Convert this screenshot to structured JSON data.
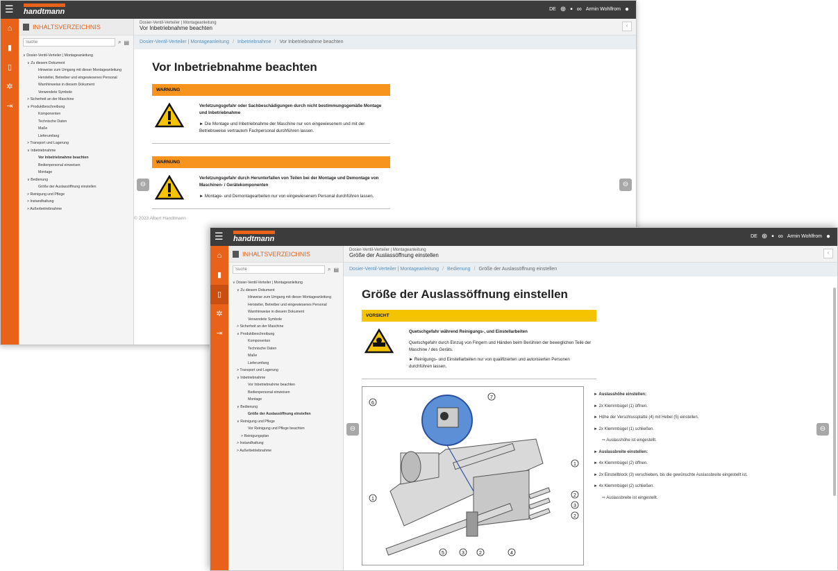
{
  "app": {
    "logo": "handtmann",
    "lang": "DE",
    "user": "Armin Wohlfrom",
    "toc_title": "INHALTSVERZEICHNIS",
    "search_placeholder": "Suche",
    "doc_title": "Dosier-Ventil-Verteiler | Montageanleitung"
  },
  "toc": [
    {
      "label": "Dosier-Ventil-Verteiler | Montageanleitung",
      "lvl": 1,
      "arrow": "∨"
    },
    {
      "label": "Zu diesem Dokument",
      "lvl": 2,
      "arrow": "∨"
    },
    {
      "label": "Hinweise zum Umgang mit dieser Montageanleitung",
      "lvl": 4
    },
    {
      "label": "Hersteller, Betreiber und eingewiesenes Personal",
      "lvl": 4
    },
    {
      "label": "Warnhinweise in diesem Dokument",
      "lvl": 4
    },
    {
      "label": "Verwendete Symbole",
      "lvl": 4
    },
    {
      "label": "Sicherheit an der Maschine",
      "lvl": 2,
      "arrow": ">"
    },
    {
      "label": "Produktbeschreibung",
      "lvl": 2,
      "arrow": "∨"
    },
    {
      "label": "Komponenten",
      "lvl": 4
    },
    {
      "label": "Technische Daten",
      "lvl": 4
    },
    {
      "label": "Maße",
      "lvl": 4
    },
    {
      "label": "Lieferumfang",
      "lvl": 4
    },
    {
      "label": "Transport und Lagerung",
      "lvl": 2,
      "arrow": ">"
    },
    {
      "label": "Inbetriebnahme",
      "lvl": 2,
      "arrow": "∨"
    },
    {
      "label": "Vor Inbetriebnahme beachten",
      "lvl": 4,
      "key": "vib"
    },
    {
      "label": "Bedienpersonal einweisen",
      "lvl": 4
    },
    {
      "label": "Montage",
      "lvl": 4
    },
    {
      "label": "Bedienung",
      "lvl": 2,
      "arrow": "∨"
    },
    {
      "label": "Größe der Auslassöffnung einstellen",
      "lvl": 4,
      "key": "gae"
    },
    {
      "label": "Reinigung und Pflege",
      "lvl": 2,
      "arrow": ">"
    },
    {
      "label": "Instandhaltung",
      "lvl": 2,
      "arrow": ">"
    },
    {
      "label": "Außerbetriebnahme",
      "lvl": 2,
      "arrow": ">"
    }
  ],
  "toc2_extra": {
    "reinigung": "Reinigung und Pflege",
    "vor_reinigung": "Vor Reinigung und Pflege beachten",
    "plan": "Reinigungsplan"
  },
  "page1": {
    "header_sub": "Dosier-Ventil-Verteiler | Montageanleitung",
    "header_title": "Vor Inbetriebnahme beachten",
    "crumbs": [
      "Dosier-Ventil-Verteiler | Montageanleitung",
      "Inbetriebnahme",
      "Vor Inbetriebnahme beachten"
    ],
    "title": "Vor Inbetriebnahme beachten",
    "w1_label": "WARNUNG",
    "w1_bold": "Verletzungsgefahr oder Sachbeschädigungen durch nicht bestimmungsgemäße Montage und Inbetriebnahme",
    "w1_step": "Die Montage und Inbetriebnahme der Maschine nur von eingewiesenem und mit der Betriebsweise vertrautem Fachpersonal durchführen lassen.",
    "w2_label": "WARNUNG",
    "w2_bold": "Verletzungsgefahr durch Herunterfallen von Teilen bei der Montage und Demontage von Maschinen- / Gerätekomponenten",
    "w2_step": "Montage- und Demontagearbeiten nur von eingewiesenem Personal durchführen lassen.",
    "footer": "© 2023 Albert Handtmann"
  },
  "page2": {
    "header_sub": "Dosier-Ventil-Verteiler | Montageanleitung",
    "header_title": "Größe der Auslassöffnung einstellen",
    "crumbs": [
      "Dosier-Ventil-Verteiler | Montageanleitung",
      "Bedienung",
      "Größe der Auslassöffnung einstellen"
    ],
    "title": "Größe der Auslassöffnung einstellen",
    "c_label": "VORSICHT",
    "c_bold": "Quetschgefahr während Reinigungs-, und Einstellarbeiten",
    "c_text": "Quetschgefahr durch Einzug von Fingern und Händen beim Berühren der beweglichen Teile der Maschine / des Geräts.",
    "c_step": "Reinigungs- und Einstellarbeiten nur von qualifizierten und autorisierten Personen durchführen lassen.",
    "steps": [
      {
        "t": "Auslasshöhe einstellen:",
        "k": "b"
      },
      {
        "t": "2x Klemmbügel (1) öffnen.",
        "k": "s"
      },
      {
        "t": "Höhe der Verschlussplatte (4) mit Hebel (5) einstellen.",
        "k": "s"
      },
      {
        "t": "2x Klemmbügel (1) schließen.",
        "k": "s"
      },
      {
        "t": "Auslasshöhe ist eingestellt.",
        "k": "r"
      },
      {
        "t": "Auslassbreite einstellen:",
        "k": "b"
      },
      {
        "t": "4x Klemmbügel (2) öffnen.",
        "k": "s"
      },
      {
        "t": "2x Einstellblock (3) verschieben, bis die gewünschte Auslassbreite eingestellt ist.",
        "k": "s"
      },
      {
        "t": "4x Klemmbügel (2) schließen.",
        "k": "s"
      },
      {
        "t": "Auslassbreite ist eingestellt.",
        "k": "r"
      }
    ],
    "callouts": [
      "1",
      "2",
      "3",
      "4",
      "5",
      "6",
      "7"
    ]
  },
  "colors": {
    "orange": "#e8621a",
    "warn": "#f7941d",
    "caution": "#f5c400"
  }
}
